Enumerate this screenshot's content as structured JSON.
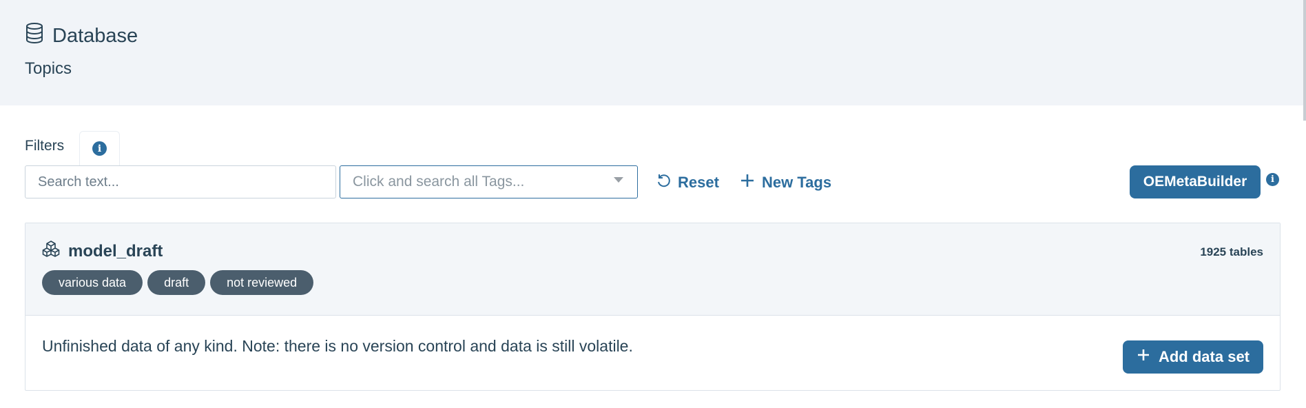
{
  "header": {
    "title": "Database",
    "title_icon": "database-icon",
    "subtitle": "Topics"
  },
  "filters": {
    "label": "Filters",
    "info_icon": "info-icon",
    "search_placeholder": "Search text...",
    "tags_placeholder": "Click and search all Tags...",
    "reset_label": "Reset",
    "new_tags_label": "New Tags",
    "oemeta_label": "OEMetaBuilder"
  },
  "topic": {
    "name": "model_draft",
    "icon": "cubes-icon",
    "count": "1925 tables",
    "tags": [
      "various data",
      "draft",
      "not reviewed"
    ],
    "description": "Unfinished data of any kind. Note: there is no version control and data is still volatile.",
    "add_label": "Add data set"
  },
  "colors": {
    "accent": "#2c6d9e",
    "header_bg": "#f1f4f8",
    "badge_bg": "#4b5e6d",
    "text": "#294456"
  }
}
